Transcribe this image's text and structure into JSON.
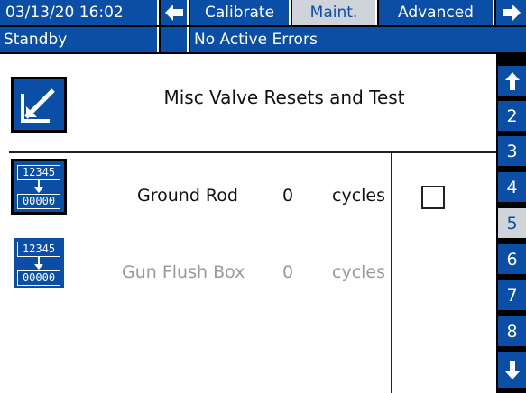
{
  "header": {
    "datetime": "03/13/20 16:02",
    "tabs": [
      "Calibrate",
      "Maint.",
      "Advanced"
    ],
    "status": "Standby",
    "errors": "No Active Errors"
  },
  "screen": {
    "title": "Misc Valve Resets and Test"
  },
  "counters": [
    {
      "label": "Ground Rod",
      "value": "0",
      "unit": "cycles",
      "icon_top": "12345",
      "icon_bottom": "00000",
      "enabled": true
    },
    {
      "label": "Gun Flush Box",
      "value": "0",
      "unit": "cycles",
      "icon_top": "12345",
      "icon_bottom": "00000",
      "enabled": false
    }
  ],
  "checkbox": {
    "checked": false
  },
  "pages": [
    "2",
    "3",
    "4",
    "5",
    "6",
    "7",
    "8"
  ],
  "active_page": "5",
  "colors": {
    "primary": "#0a4ea6",
    "active_tab": "#cfd4da",
    "disabled_text": "#9a9a9a"
  }
}
